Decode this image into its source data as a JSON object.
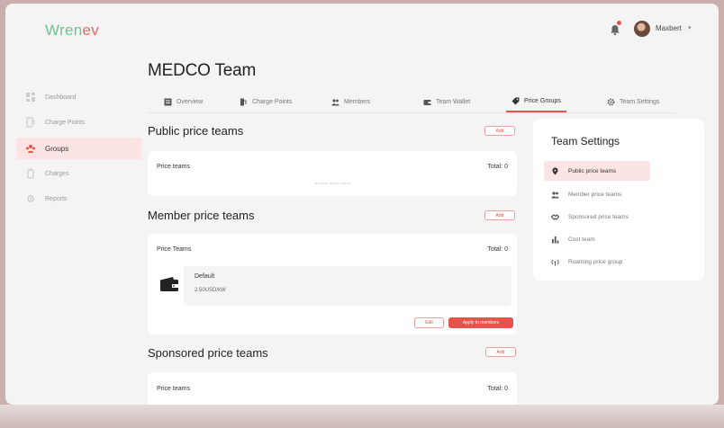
{
  "header": {
    "logo_main": "Wren",
    "logo_accent": "ev",
    "user_name": "Maxbert",
    "colors": {
      "brand": "#6fc48e",
      "accent": "#e5534b"
    }
  },
  "sidebar": {
    "items": [
      {
        "label": "Dashboard",
        "icon": "dashboard-icon"
      },
      {
        "label": "Charge Points",
        "icon": "charge-point-icon"
      },
      {
        "label": "Groups",
        "icon": "groups-icon"
      },
      {
        "label": "Charges",
        "icon": "charges-icon"
      },
      {
        "label": "Reports",
        "icon": "reports-icon"
      }
    ],
    "active": "Groups"
  },
  "page": {
    "title": "MEDCO Team"
  },
  "tabs": [
    {
      "label": "Overview",
      "icon": "overview-icon"
    },
    {
      "label": "Charge Points",
      "icon": "charge-points-icon"
    },
    {
      "label": "Members",
      "icon": "members-icon"
    },
    {
      "label": "Team Wallet",
      "icon": "wallet-icon"
    },
    {
      "label": "Price Groups",
      "icon": "tag-icon"
    },
    {
      "label": "Team Settings",
      "icon": "gear-icon"
    }
  ],
  "active_tab": "Price Groups",
  "sections": {
    "public": {
      "title": "Public price teams",
      "add_label": "Add",
      "list_label": "Price teams",
      "total": "Total: 0",
      "empty": "No price groups found"
    },
    "member": {
      "title": "Member price teams",
      "add_label": "Add",
      "list_label": "Price Teams",
      "total": "Total: 0",
      "item": {
        "name": "Default",
        "price": "2.50USD/kW"
      },
      "edit_label": "Edit",
      "apply_label": "Apply to members"
    },
    "sponsored": {
      "title": "Sponsored price teams",
      "add_label": "Add",
      "list_label": "Price teams",
      "total": "Total: 0"
    }
  },
  "settings": {
    "title": "Team Settings",
    "items": [
      {
        "label": "Public price teams",
        "icon": "location-pin-icon"
      },
      {
        "label": "Member price teams",
        "icon": "members-icon"
      },
      {
        "label": "Sponsored price teams",
        "icon": "handshake-icon"
      },
      {
        "label": "Cost team",
        "icon": "bar-chart-icon"
      },
      {
        "label": "Roaming price group",
        "icon": "roaming-icon"
      }
    ]
  }
}
